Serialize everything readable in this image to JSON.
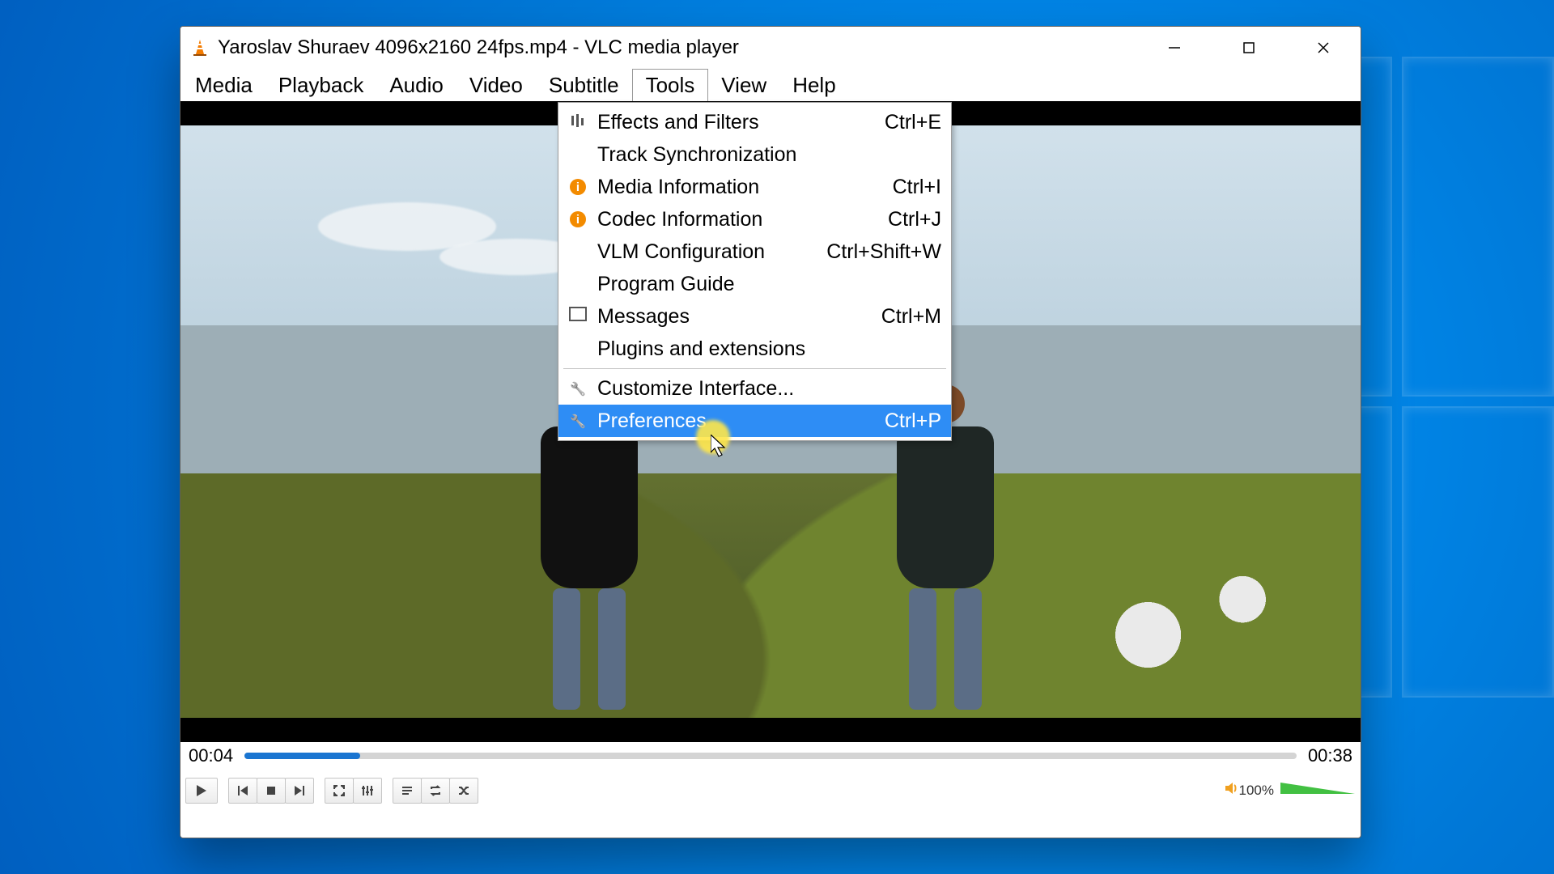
{
  "window": {
    "title": "Yaroslav Shuraev 4096x2160 24fps.mp4 - VLC media player"
  },
  "menubar": {
    "items": [
      "Media",
      "Playback",
      "Audio",
      "Video",
      "Subtitle",
      "Tools",
      "View",
      "Help"
    ],
    "open_index": 5
  },
  "tools_menu": {
    "groups": [
      [
        {
          "icon": "eq",
          "label": "Effects and Filters",
          "shortcut": "Ctrl+E"
        },
        {
          "icon": "",
          "label": "Track Synchronization",
          "shortcut": ""
        },
        {
          "icon": "info",
          "label": "Media Information",
          "shortcut": "Ctrl+I"
        },
        {
          "icon": "info",
          "label": "Codec Information",
          "shortcut": "Ctrl+J"
        },
        {
          "icon": "",
          "label": "VLM Configuration",
          "shortcut": "Ctrl+Shift+W"
        },
        {
          "icon": "",
          "label": "Program Guide",
          "shortcut": ""
        },
        {
          "icon": "msg",
          "label": "Messages",
          "shortcut": "Ctrl+M"
        },
        {
          "icon": "",
          "label": "Plugins and extensions",
          "shortcut": ""
        }
      ],
      [
        {
          "icon": "wrench",
          "label": "Customize Interface...",
          "shortcut": ""
        },
        {
          "icon": "wrench",
          "label": "Preferences",
          "shortcut": "Ctrl+P",
          "highlight": true
        }
      ]
    ]
  },
  "playback": {
    "elapsed": "00:04",
    "total": "00:38",
    "progress_percent": 11
  },
  "controls": {
    "volume_label": "100%"
  }
}
